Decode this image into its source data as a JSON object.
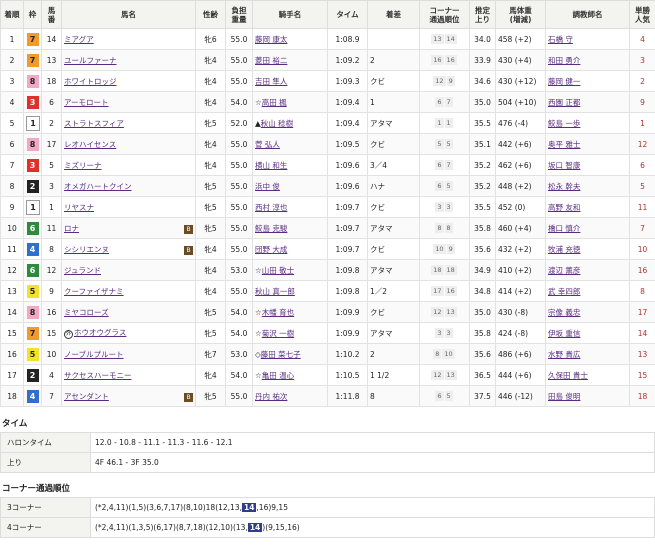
{
  "headers": {
    "rank": "着順",
    "frame": "枠",
    "num": "馬\n番",
    "horse": "馬名",
    "sexage": "性齢",
    "weight": "負担\n重量",
    "jockey": "騎手名",
    "time": "タイム",
    "margin": "着差",
    "corner": "コーナー\n通過順位",
    "last": "推定\n上り",
    "body": "馬体重\n(増減)",
    "trainer": "調教師名",
    "pop": "単勝\n人気"
  },
  "rows": [
    {
      "rank": "1",
      "frame": "7",
      "num": "14",
      "horse": "ミアグア",
      "b": "",
      "sexage": "牝6",
      "weight": "55.0",
      "jmark": "",
      "jockey": "藤岡 康太",
      "time": "1:08.9",
      "margin": "",
      "corners": [
        "13",
        "14"
      ],
      "last": "34.0",
      "body": "458 (+2)",
      "trainer": "石橋 守",
      "pop": "4"
    },
    {
      "rank": "2",
      "frame": "7",
      "num": "13",
      "horse": "ユールファーナ",
      "b": "",
      "sexage": "牝4",
      "weight": "55.0",
      "jmark": "",
      "jockey": "菱田 裕二",
      "time": "1:09.2",
      "margin": "2",
      "corners": [
        "16",
        "16"
      ],
      "last": "33.9",
      "body": "430 (+4)",
      "trainer": "和田 勇介",
      "pop": "3"
    },
    {
      "rank": "3",
      "frame": "8",
      "num": "18",
      "horse": "ホワイトロッジ",
      "b": "",
      "sexage": "牝4",
      "weight": "55.0",
      "jmark": "",
      "jockey": "吉田 隼人",
      "time": "1:09.3",
      "margin": "クビ",
      "corners": [
        "12",
        "9"
      ],
      "last": "34.6",
      "body": "430 (+12)",
      "trainer": "藤岡 健一",
      "pop": "2"
    },
    {
      "rank": "4",
      "frame": "3",
      "num": "6",
      "horse": "アーモロート",
      "b": "",
      "sexage": "牝4",
      "weight": "54.0",
      "jmark": "☆",
      "jockey": "高田 楓",
      "time": "1:09.4",
      "margin": "1",
      "corners": [
        "6",
        "7"
      ],
      "last": "35.0",
      "body": "504 (+10)",
      "trainer": "西園 正都",
      "pop": "9"
    },
    {
      "rank": "5",
      "frame": "1",
      "num": "2",
      "horse": "ストラトスフィア",
      "b": "",
      "sexage": "牝5",
      "weight": "52.0",
      "jmark": "▲",
      "jockey": "秋山 稔樹",
      "time": "1:09.4",
      "margin": "アタマ",
      "corners": [
        "1",
        "1"
      ],
      "last": "35.5",
      "body": "476 (-4)",
      "trainer": "鮫島 一歩",
      "pop": "1"
    },
    {
      "rank": "6",
      "frame": "8",
      "num": "17",
      "horse": "レオハイセンス",
      "b": "",
      "sexage": "牝4",
      "weight": "55.0",
      "jmark": "",
      "jockey": "菅 弘人",
      "time": "1:09.5",
      "margin": "クビ",
      "corners": [
        "5",
        "5"
      ],
      "last": "35.1",
      "body": "442 (+6)",
      "trainer": "奥平 雅士",
      "pop": "12"
    },
    {
      "rank": "7",
      "frame": "3",
      "num": "5",
      "horse": "ミズリーナ",
      "b": "",
      "sexage": "牝4",
      "weight": "55.0",
      "jmark": "",
      "jockey": "横山 和生",
      "time": "1:09.6",
      "margin": "3／4",
      "corners": [
        "6",
        "7"
      ],
      "last": "35.2",
      "body": "462 (+6)",
      "trainer": "坂口 智康",
      "pop": "6"
    },
    {
      "rank": "8",
      "frame": "2",
      "num": "3",
      "horse": "オメガハートクイン",
      "b": "",
      "sexage": "牝5",
      "weight": "55.0",
      "jmark": "",
      "jockey": "浜中 俊",
      "time": "1:09.6",
      "margin": "ハナ",
      "corners": [
        "6",
        "5"
      ],
      "last": "35.2",
      "body": "448 (+2)",
      "trainer": "松永 幹夫",
      "pop": "5"
    },
    {
      "rank": "9",
      "frame": "1",
      "num": "1",
      "horse": "リヤスナ",
      "b": "",
      "sexage": "牝5",
      "weight": "55.0",
      "jmark": "",
      "jockey": "西村 淳也",
      "time": "1:09.7",
      "margin": "クビ",
      "corners": [
        "3",
        "3"
      ],
      "last": "35.5",
      "body": "452 (0)",
      "trainer": "高野 友和",
      "pop": "11"
    },
    {
      "rank": "10",
      "frame": "6",
      "num": "11",
      "horse": "ロナ",
      "b": "B",
      "sexage": "牝5",
      "weight": "55.0",
      "jmark": "",
      "jockey": "鮫島 克駿",
      "time": "1:09.7",
      "margin": "アタマ",
      "corners": [
        "8",
        "8"
      ],
      "last": "35.8",
      "body": "460 (+4)",
      "trainer": "橋口 慎介",
      "pop": "7"
    },
    {
      "rank": "11",
      "frame": "4",
      "num": "8",
      "horse": "シシリエンヌ",
      "b": "B",
      "sexage": "牝4",
      "weight": "55.0",
      "jmark": "",
      "jockey": "団野 大成",
      "time": "1:09.7",
      "margin": "クビ",
      "corners": [
        "10",
        "9"
      ],
      "last": "35.6",
      "body": "432 (+2)",
      "trainer": "牧浦 充徳",
      "pop": "10"
    },
    {
      "rank": "12",
      "frame": "6",
      "num": "12",
      "horse": "ジュランド",
      "b": "",
      "sexage": "牝4",
      "weight": "53.0",
      "jmark": "☆",
      "jockey": "山田 敬士",
      "time": "1:09.8",
      "margin": "アタマ",
      "corners": [
        "18",
        "18"
      ],
      "last": "34.9",
      "body": "410 (+2)",
      "trainer": "渡辺 薫彦",
      "pop": "16"
    },
    {
      "rank": "13",
      "frame": "5",
      "num": "9",
      "horse": "クーファイザナミ",
      "b": "",
      "sexage": "牝4",
      "weight": "55.0",
      "jmark": "",
      "jockey": "秋山 真一郎",
      "time": "1:09.8",
      "margin": "1／2",
      "corners": [
        "17",
        "16"
      ],
      "last": "34.8",
      "body": "414 (+2)",
      "trainer": "武 幸四郎",
      "pop": "8"
    },
    {
      "rank": "14",
      "frame": "8",
      "num": "16",
      "horse": "ミヤコローズ",
      "b": "",
      "sexage": "牝5",
      "weight": "54.0",
      "jmark": "☆",
      "jockey": "木幡 育也",
      "time": "1:09.9",
      "margin": "クビ",
      "corners": [
        "12",
        "13"
      ],
      "last": "35.0",
      "body": "430 (-8)",
      "trainer": "宗像 義忠",
      "pop": "17"
    },
    {
      "rank": "15",
      "frame": "7",
      "num": "15",
      "horse": "ホウオウグラス",
      "b": "",
      "circ": "外",
      "sexage": "牝5",
      "weight": "54.0",
      "jmark": "☆",
      "jockey": "菊沢 一樹",
      "time": "1:09.9",
      "margin": "アタマ",
      "corners": [
        "3",
        "3"
      ],
      "last": "35.8",
      "body": "424 (-8)",
      "trainer": "伊坂 重信",
      "pop": "14"
    },
    {
      "rank": "16",
      "frame": "5",
      "num": "10",
      "horse": "ノーブルプルート",
      "b": "",
      "sexage": "牝7",
      "weight": "53.0",
      "jmark": "◇",
      "jockey": "藤田 菜七子",
      "time": "1:10.2",
      "margin": "2",
      "corners": [
        "8",
        "10"
      ],
      "last": "35.6",
      "body": "486 (+6)",
      "trainer": "水野 貴広",
      "pop": "13"
    },
    {
      "rank": "17",
      "frame": "2",
      "num": "4",
      "horse": "サクセスハーモニー",
      "b": "",
      "sexage": "牝4",
      "weight": "54.0",
      "jmark": "☆",
      "jockey": "亀田 温心",
      "time": "1:10.5",
      "margin": "1 1/2",
      "corners": [
        "12",
        "13"
      ],
      "last": "36.5",
      "body": "444 (+6)",
      "trainer": "久保田 貴士",
      "pop": "15"
    },
    {
      "rank": "18",
      "frame": "4",
      "num": "7",
      "horse": "アセンダント",
      "b": "B",
      "sexage": "牝5",
      "weight": "55.0",
      "jmark": "",
      "jockey": "丹内 祐次",
      "time": "1:11.8",
      "margin": "8",
      "corners": [
        "6",
        "5"
      ],
      "last": "37.5",
      "body": "446 (-12)",
      "trainer": "田島 俊明",
      "pop": "18"
    }
  ],
  "time_section": {
    "title": "タイム",
    "lap_label": "ハロンタイム",
    "lap_value": "12.0 - 10.8 - 11.1 - 11.3 - 11.6 - 12.1",
    "agari_label": "上り",
    "agari_value": "4F 46.1 - 3F 35.0"
  },
  "corner_section": {
    "title": "コーナー通過順位",
    "c3_label": "3コーナー",
    "c3_pre": "(*2,4,11)(1,5)(3,6,7,17)(8,10)18(12,13,",
    "c3_hl": "14",
    "c3_post": ",16)9,15",
    "c4_label": "4コーナー",
    "c4_pre": "(*2,4,11)(1,3,5)(6,17)(8,7,18)(12,10)(13,",
    "c4_hl": "14",
    "c4_post": ")(9,15,16)"
  },
  "frame_colors": {
    "1": [
      "#ffffff",
      "#222"
    ],
    "2": [
      "#222222",
      "#fff"
    ],
    "3": [
      "#e0302a",
      "#fff"
    ],
    "4": [
      "#2f6fd0",
      "#fff"
    ],
    "5": [
      "#f4e12a",
      "#222"
    ],
    "6": [
      "#2e8b3e",
      "#fff"
    ],
    "7": [
      "#f29a2e",
      "#222"
    ],
    "8": [
      "#f4a7c3",
      "#222"
    ]
  }
}
